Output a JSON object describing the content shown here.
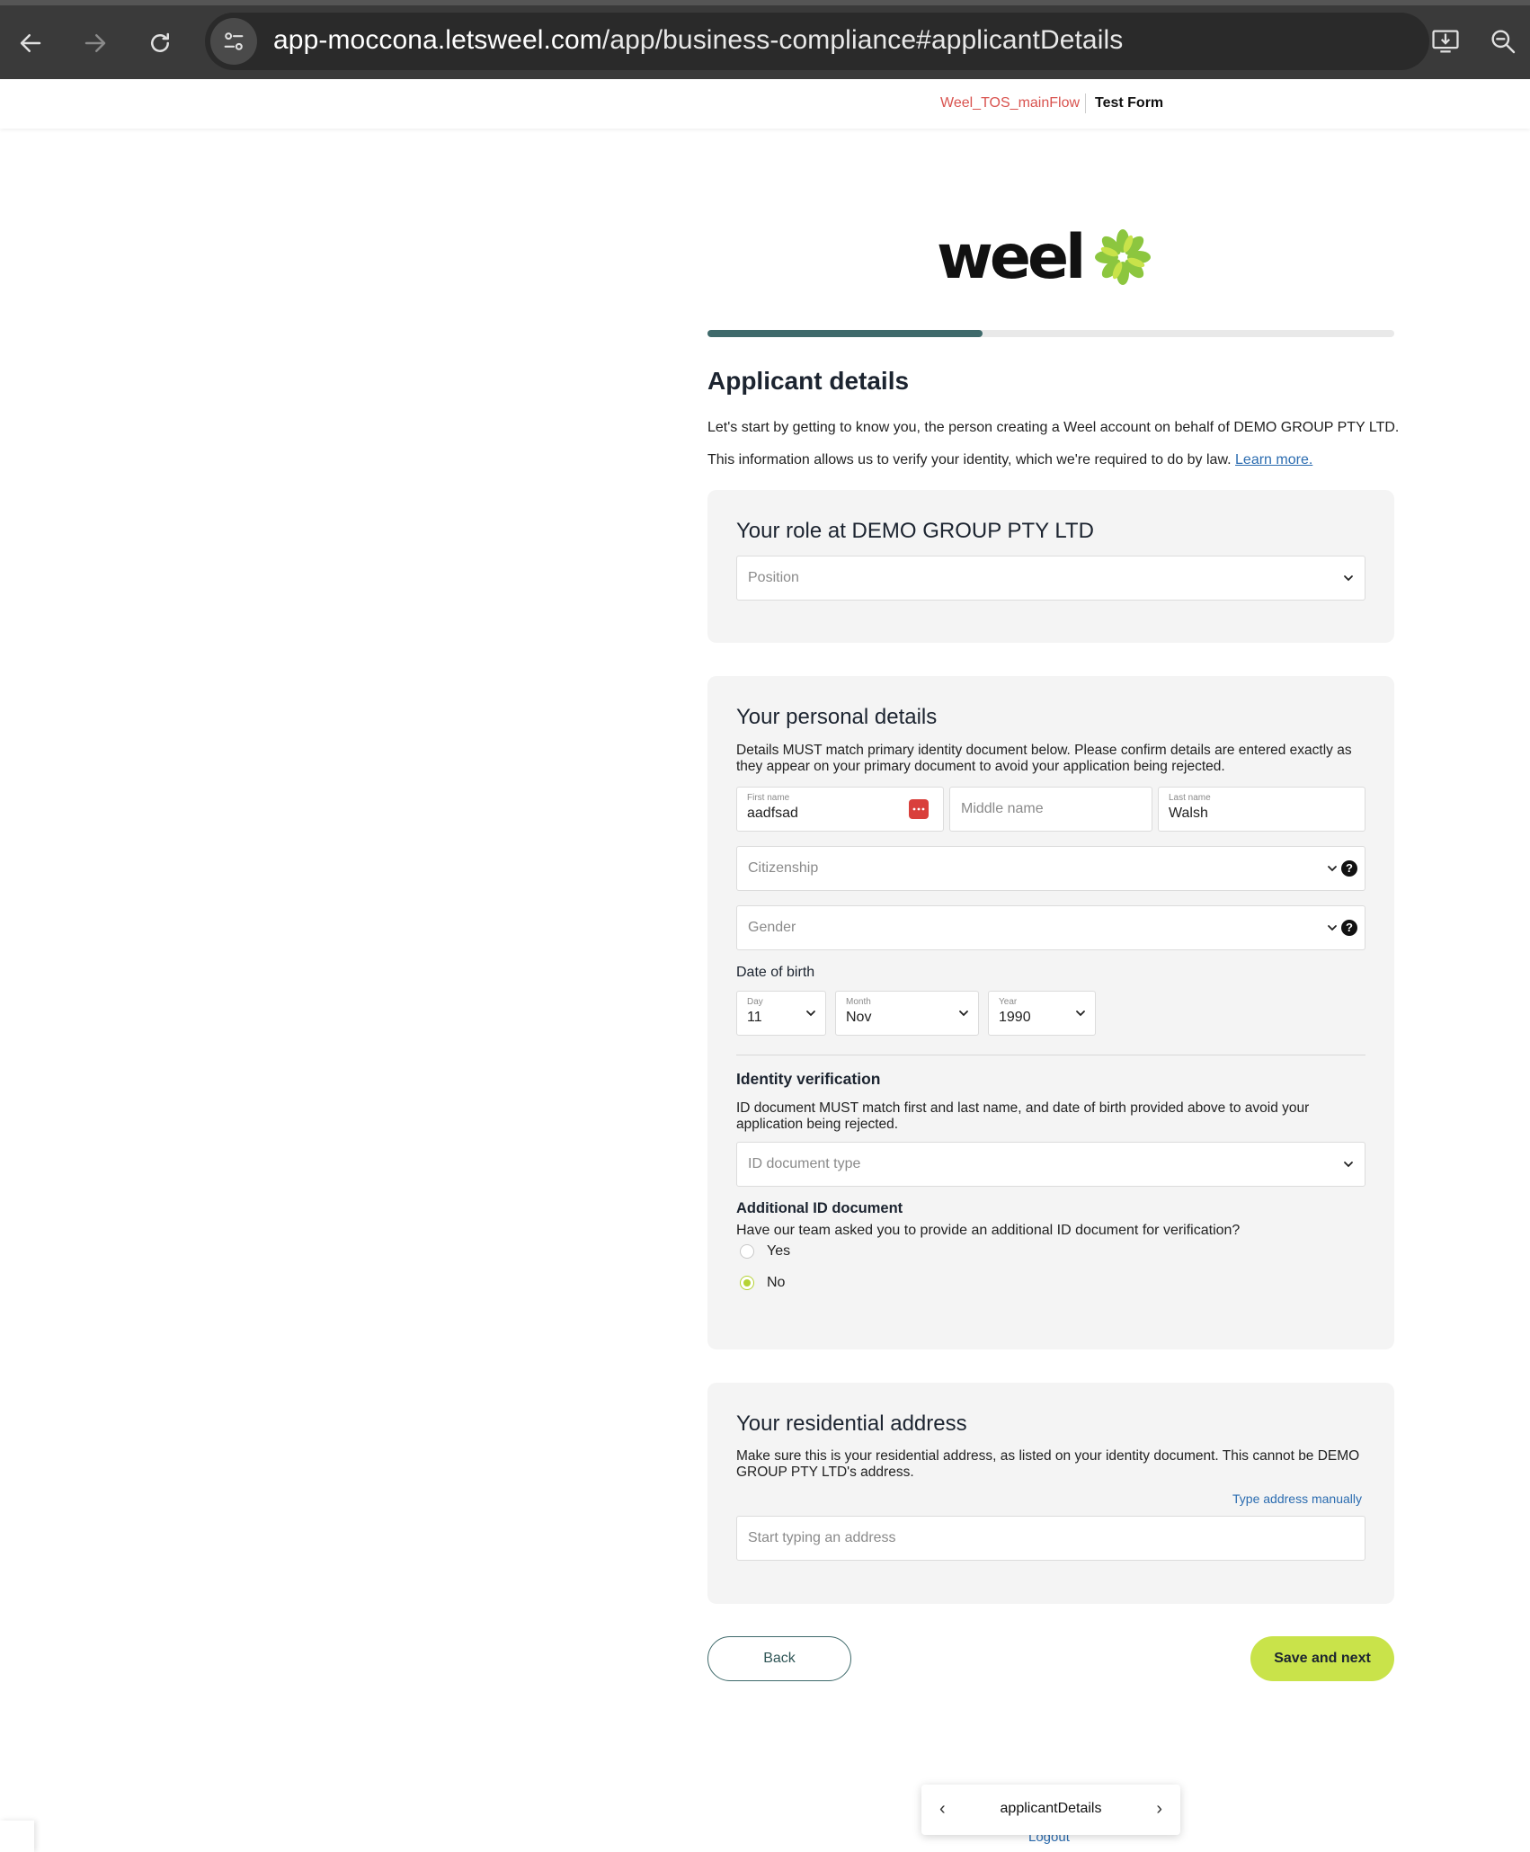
{
  "browser": {
    "url_host": "app-moccona.letsweel.com",
    "url_path": "/app/business-compliance#applicantDetails"
  },
  "header": {
    "flow_name": "Weel_TOS_mainFlow",
    "form_name": "Test Form"
  },
  "logo": {
    "text": "weel"
  },
  "progress": {
    "fraction": 0.4,
    "fill_color": "#3f6a6b"
  },
  "page": {
    "title": "Applicant details",
    "intro_1": "Let's start by getting to know you, the person creating a Weel account on behalf of DEMO GROUP PTY LTD.",
    "intro_2": "This information allows us to verify your identity, which we're required to do by law.",
    "learn_more": "Learn more."
  },
  "role_card": {
    "title": "Your role at DEMO GROUP PTY LTD",
    "position_placeholder": "Position"
  },
  "personal_card": {
    "title": "Your personal details",
    "description": "Details MUST match primary identity document below. Please confirm details are entered exactly as they appear on your primary document to avoid your application being rejected.",
    "first_name_label": "First name",
    "first_name_value": "aadfsad",
    "middle_name_placeholder": "Middle name",
    "last_name_label": "Last name",
    "last_name_value": "Walsh",
    "citizenship_placeholder": "Citizenship",
    "gender_placeholder": "Gender",
    "dob_label": "Date of birth",
    "dob_day_label": "Day",
    "dob_day_value": "11",
    "dob_month_label": "Month",
    "dob_month_value": "Nov",
    "dob_year_label": "Year",
    "dob_year_value": "1990",
    "identity_title": "Identity verification",
    "identity_description": "ID document MUST match first and last name, and date of birth provided above to avoid your application being rejected.",
    "id_type_placeholder": "ID document type",
    "additional_title": "Additional ID document",
    "additional_question": "Have our team asked you to provide an additional ID document for verification?",
    "option_yes": "Yes",
    "option_no": "No",
    "selected_option": "No"
  },
  "address_card": {
    "title": "Your residential address",
    "description": "Make sure this is your residential address, as listed on your identity document. This cannot be DEMO GROUP PTY LTD's address.",
    "manual_link": "Type address manually",
    "address_placeholder": "Start typing an address"
  },
  "actions": {
    "back": "Back",
    "save": "Save and next"
  },
  "step_nav": {
    "current_step": "applicantDetails",
    "logout": "Logout"
  },
  "colors": {
    "accent_green": "#c9e34a",
    "teal": "#3f6a6b",
    "link_blue": "#2b6cb0",
    "flow_red": "#d9534f"
  }
}
